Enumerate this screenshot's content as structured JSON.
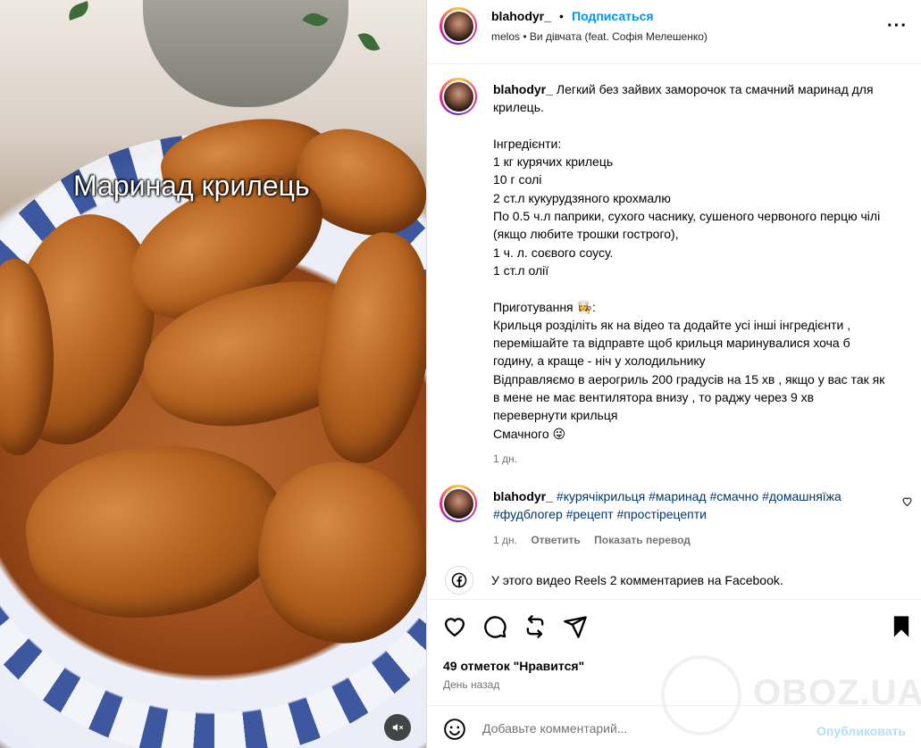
{
  "media": {
    "overlay_text": "Маринад крилець"
  },
  "header": {
    "username": "blahodyr_",
    "separator": "•",
    "follow_label": "Подписаться",
    "audio": "melos • Ви дівчата (feat. Софія Мелешенко)",
    "more_label": "···"
  },
  "caption": {
    "username": "blahodyr_",
    "text": "Легкий без зайвих заморочок та смачний маринад для крилець.\n\nІнгредієнти:\n1 кг курячих крилець\n10 г солі\n2 ст.л кукурудзяного крохмалю\nПо 0.5 ч.л паприки, сухого часнику, сушеного червоного перцю чілі (якщо любите трошки гострого),\n1 ч. л. соєвого соусу.\n1 ст.л олії\n\nПриготування 👩‍🍳:\nКрильця розділіть як на відео та додайте усі інші інгредієнти , перемішайте та відправте щоб крильця маринувалися хоча б годину, а краще - ніч у холодильнику\nВідправляємо в аерогриль 200 градусів на 15 хв , якщо у вас так як в мене не має вентилятора внизу , то раджу через 9 хв перевернути крильця\nСмачного 😜",
    "age": "1 дн."
  },
  "comment": {
    "username": "blahodyr_",
    "hashtags": "#курячікрильця #маринад #смачно #домашняїжа #фудблогер #рецепт #простірецепти",
    "age": "1 дн.",
    "reply_label": "Ответить",
    "translate_label": "Показать перевод"
  },
  "facebook": {
    "text": "У этого видео Reels 2 комментариев на Facebook."
  },
  "actions": {
    "likes": "49 отметок \"Нравится\"",
    "posted": "День назад",
    "watermark": "OBOZ.UA"
  },
  "composer": {
    "placeholder": "Добавьте комментарий...",
    "publish_label": "Опубликовать"
  },
  "colors": {
    "accent": "#0095f6",
    "publish_disabled": "#b2dffc",
    "hashtag": "#00376b",
    "secondary_text": "#737373"
  }
}
